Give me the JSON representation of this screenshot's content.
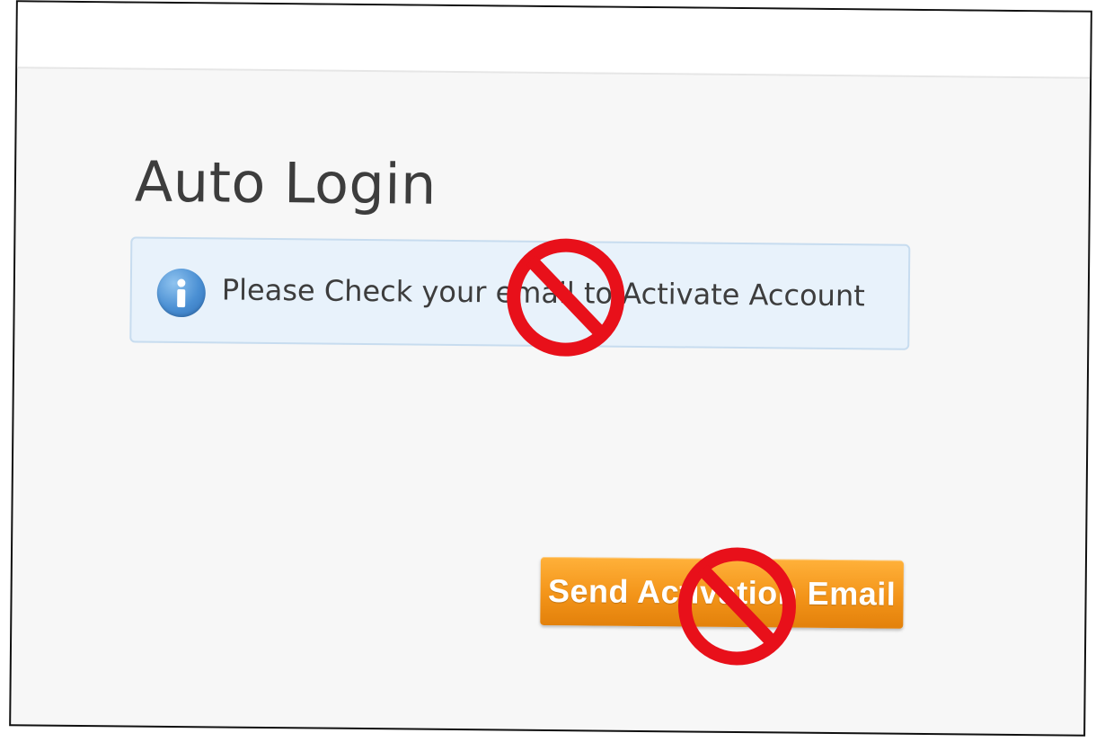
{
  "page": {
    "title": "Auto Login"
  },
  "alert": {
    "icon": "info-icon",
    "message": "Please Check your email to Activate Account"
  },
  "actions": {
    "send_activation_label": "Send Activation Email"
  },
  "overlays": {
    "icon": "prohibited-icon",
    "color": "#e8101a"
  },
  "colors": {
    "button_orange": "#f39419",
    "alert_background": "#e8f2fb",
    "info_blue": "#4a8fd3"
  }
}
